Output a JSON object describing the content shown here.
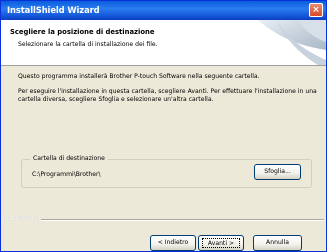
{
  "window": {
    "title": "InstallShield Wizard",
    "close_symbol": "×"
  },
  "header": {
    "title": "Scegliere la posizione di destinazione",
    "subtitle": "Selezionare la cartella di installazione dei file."
  },
  "body": {
    "paragraph1": "Questo programma installerà Brother P-touch Software nella seguente cartella.",
    "paragraph2": "Per eseguire l'installazione in questa cartella, scegliere Avanti. Per effettuare l'installazione in una cartella diversa, scegliere Sfoglia e selezionare un'altra cartella."
  },
  "destination": {
    "group_label": "Cartella di destinazione",
    "path": "C:\\Programmi\\Brother\\",
    "browse_label": "Sfoglia..."
  },
  "footer": {
    "brand": "InstallShield",
    "back_label": "< Indietro",
    "next_label": "Avanti >",
    "cancel_label": "Annulla"
  },
  "colors": {
    "title_bar": "#0a5ddc",
    "window_bg": "#ece9d8",
    "header_bg": "#ffffff"
  },
  "icons": {
    "close": "close-icon",
    "header_art": "installshield-swoosh-icon"
  }
}
